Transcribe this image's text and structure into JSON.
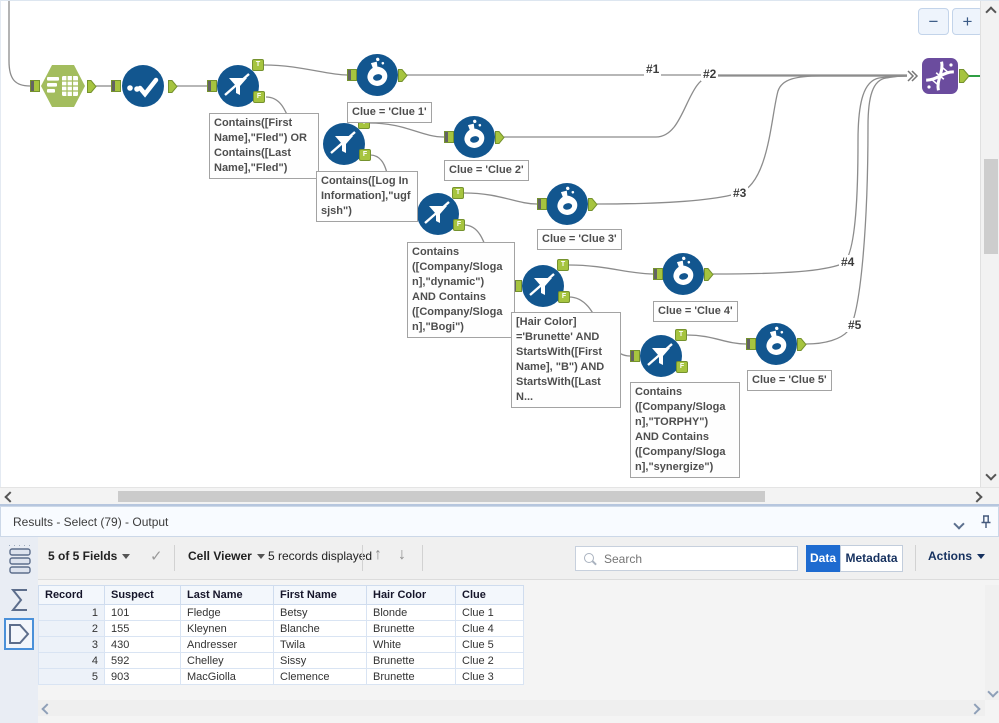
{
  "colors": {
    "tool_blue": "#12568f",
    "tool_green": "#a3bd5e",
    "tool_purple": "#6b4c9e",
    "anchor_green": "#a6c43f",
    "wire_gray": "#8c8c8c",
    "wire_green": "#2f9e44",
    "accent_blue": "#1e6bd0"
  },
  "canvas": {
    "zoom_out_label": "−",
    "zoom_in_label": "+",
    "anchor_true": "T",
    "anchor_false": "F",
    "wire_labels": [
      "#1",
      "#2",
      "#3",
      "#4",
      "#5"
    ],
    "annotations": [
      "Contains([First\nName],\"Fled\") OR\nContains([Last\nName],\"Fled\")",
      "Contains([Log In\nInformation],\"ugf\nsjsh\")",
      "Clue = 'Clue 1'",
      "Clue = 'Clue 2'",
      "Clue = 'Clue 3'",
      "Contains\n([Company/Sloga\nn],\"dynamic\")\nAND Contains\n([Company/Sloga\nn],\"Bogi\")",
      "[Hair Color]\n='Brunette' AND\nStartsWith([First\nName], \"B\") AND\nStartsWith([Last\nN...",
      "Clue = 'Clue 4'",
      "Contains\n([Company/Sloga\nn],\"TORPHY\")\nAND Contains\n([Company/Sloga\nn],\"synergize\")",
      "Clue = 'Clue 5'"
    ]
  },
  "results_panel": {
    "title": "Results - Select (79) - Output",
    "toolbar": {
      "fields_summary": "5 of 5 Fields",
      "check_icon": "✓",
      "cell_viewer_label": "Cell Viewer",
      "records_displayed": "5 records displayed",
      "up_arrow": "↑",
      "down_arrow": "↓",
      "search_placeholder": "Search",
      "data_tab": "Data",
      "metadata_tab": "Metadata",
      "actions_label": "Actions"
    },
    "table": {
      "columns": [
        "Record",
        "Suspect",
        "Last Name",
        "First Name",
        "Hair Color",
        "Clue"
      ],
      "rows": [
        [
          "1",
          "101",
          "Fledge",
          "Betsy",
          "Blonde",
          "Clue 1"
        ],
        [
          "2",
          "155",
          "Kleynen",
          "Blanche",
          "Brunette",
          "Clue 4"
        ],
        [
          "3",
          "430",
          "Andresser",
          "Twila",
          "White",
          "Clue 5"
        ],
        [
          "4",
          "592",
          "Chelley",
          "Sissy",
          "Brunette",
          "Clue 2"
        ],
        [
          "5",
          "903",
          "MacGiolla",
          "Clemence",
          "Brunette",
          "Clue 3"
        ]
      ]
    }
  }
}
